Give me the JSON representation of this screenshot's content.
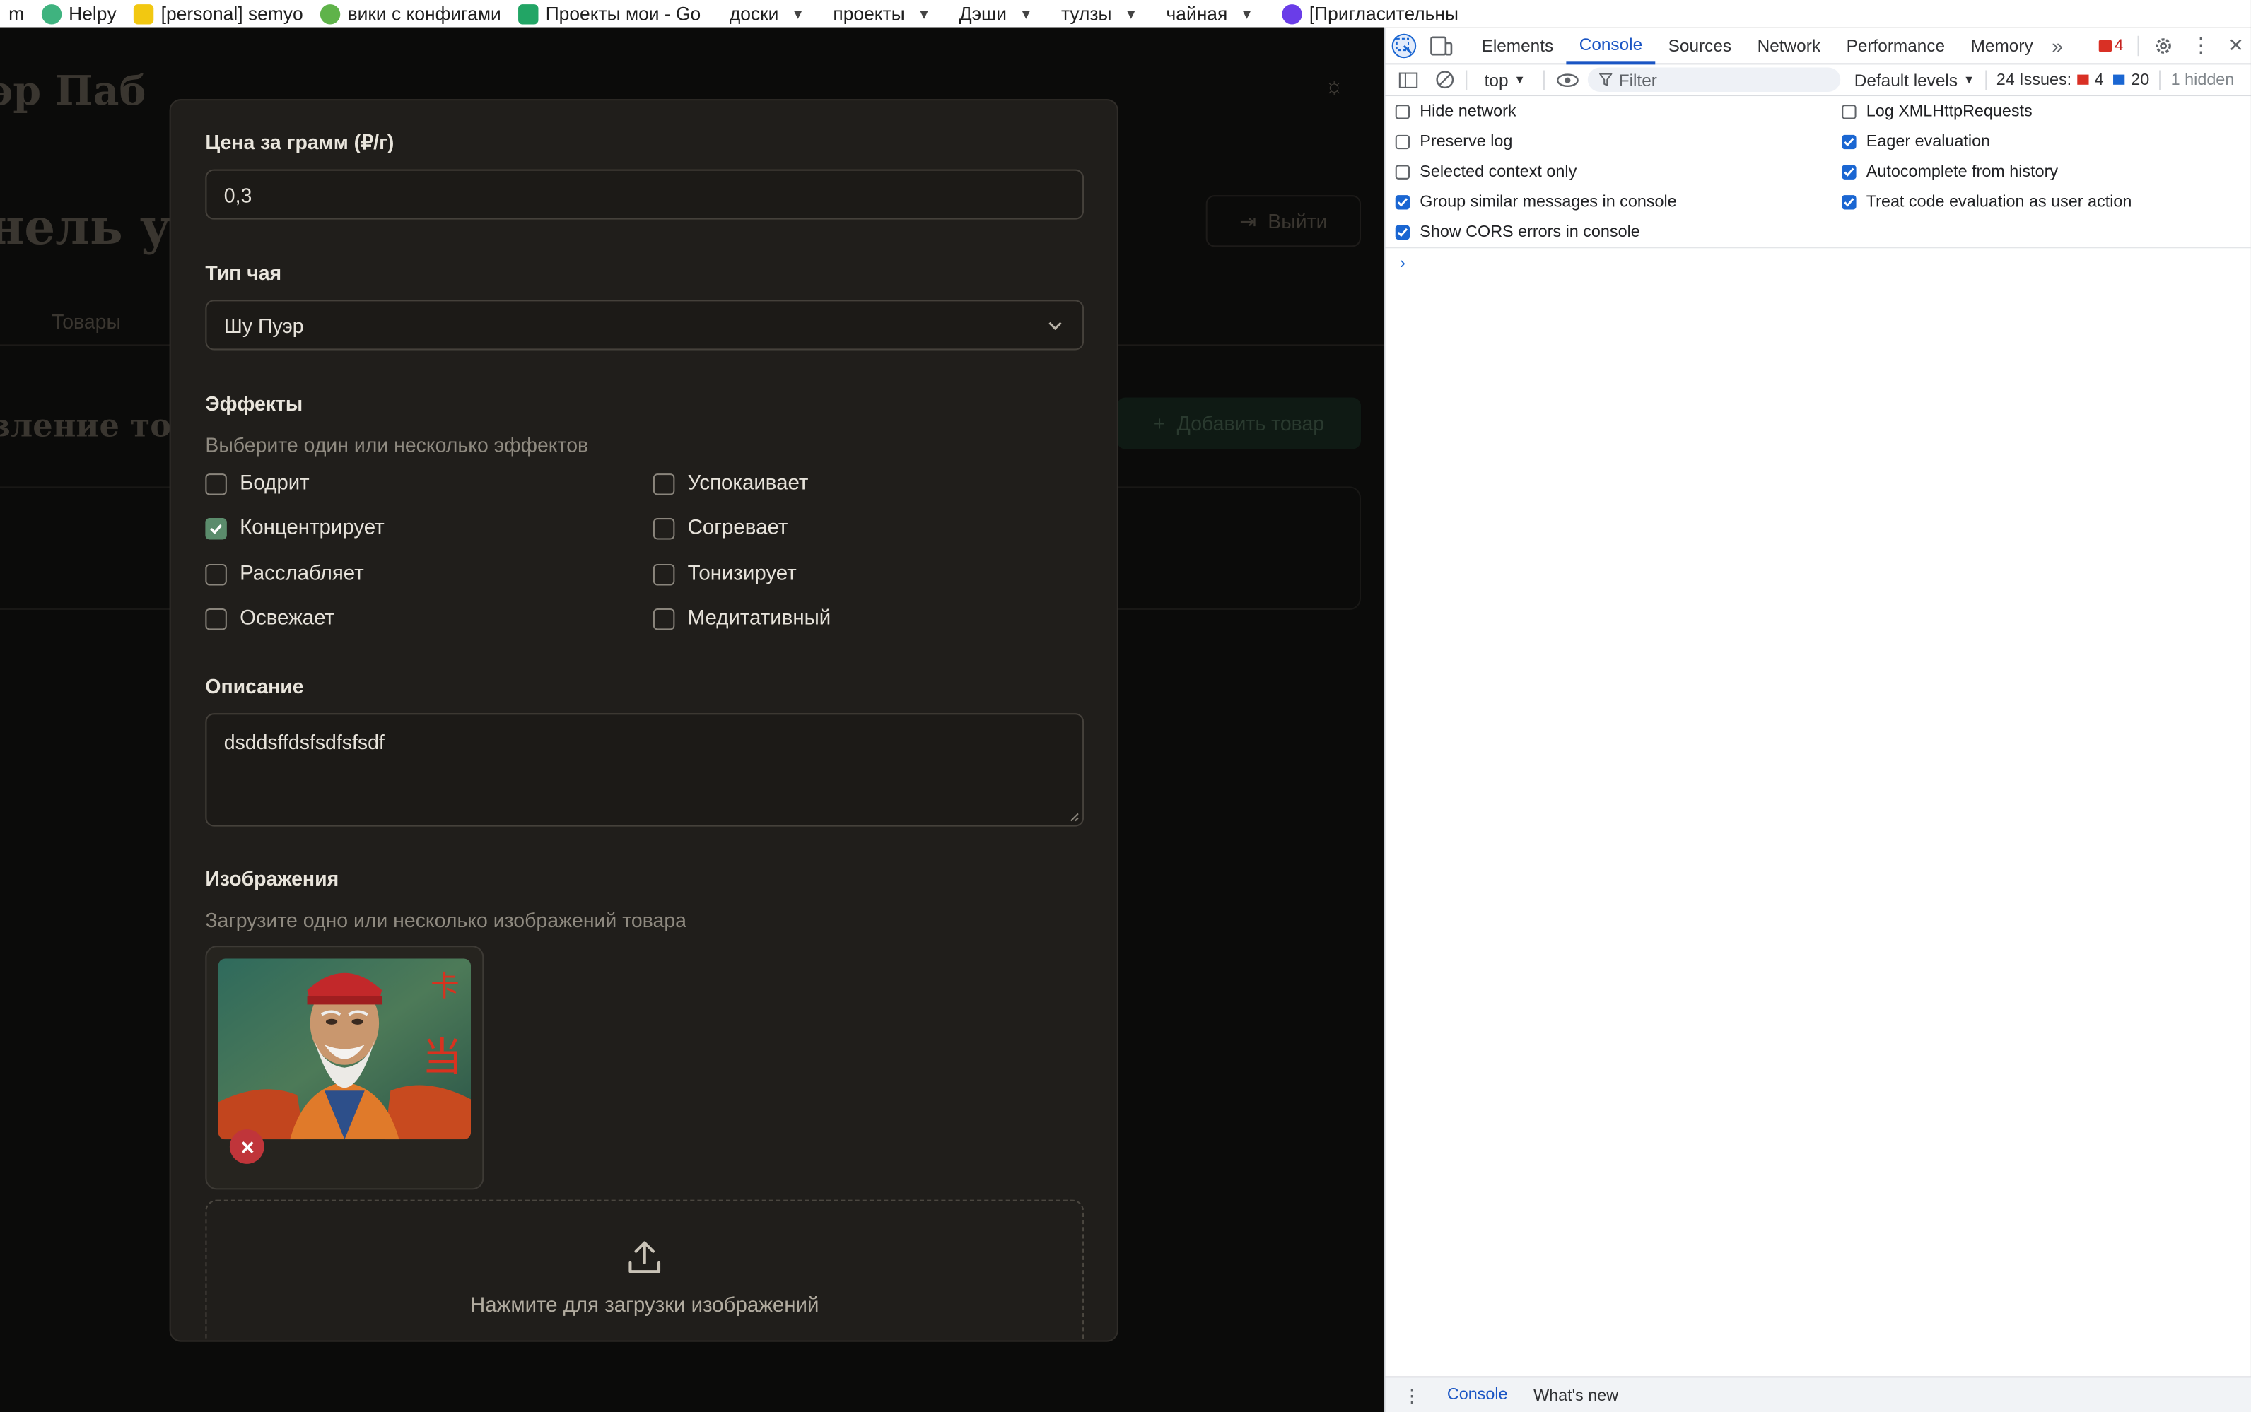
{
  "bookmarks": [
    {
      "label": "m",
      "color": "#ffffff",
      "dropdown": false
    },
    {
      "label": "Helpy",
      "color": "#3fb37f",
      "dropdown": false
    },
    {
      "label": "[personal] semyo",
      "color": "#f2c811",
      "dropdown": false
    },
    {
      "label": "вики с конфигами",
      "color": "#5fb34a",
      "dropdown": false
    },
    {
      "label": "Проекты мои - Go",
      "color": "#22a565",
      "dropdown": false
    },
    {
      "label": "доски",
      "color": "",
      "dropdown": true
    },
    {
      "label": "проекты",
      "color": "",
      "dropdown": true
    },
    {
      "label": "Дэши",
      "color": "",
      "dropdown": true
    },
    {
      "label": "тулзы",
      "color": "",
      "dropdown": true
    },
    {
      "label": "чайная",
      "color": "",
      "dropdown": true
    },
    {
      "label": "[Пригласительны",
      "color": "#6a3de8",
      "dropdown": false
    }
  ],
  "background": {
    "brand": "эр Паб",
    "panel_title": "нель уп",
    "tab_products": "Товары",
    "manage_title": "вление то",
    "logout": "Выйти",
    "add_product": "Добавить товар"
  },
  "form": {
    "price_label": "Цена за грамм (₽/г)",
    "price_value": "0,3",
    "tea_type_label": "Тип чая",
    "tea_type_value": "Шу Пуэр",
    "effects_label": "Эффекты",
    "effects_hint": "Выберите один или несколько эффектов",
    "effects": [
      {
        "label": "Бодрит",
        "checked": false
      },
      {
        "label": "Успокаивает",
        "checked": false
      },
      {
        "label": "Концентрирует",
        "checked": true
      },
      {
        "label": "Согревает",
        "checked": false
      },
      {
        "label": "Расслабляет",
        "checked": false
      },
      {
        "label": "Тонизирует",
        "checked": false
      },
      {
        "label": "Освежает",
        "checked": false
      },
      {
        "label": "Медитативный",
        "checked": false
      }
    ],
    "description_label": "Описание",
    "description_value": "dsddsffdsfsdfsfsdf",
    "images_label": "Изображения",
    "images_hint": "Загрузите одно или несколько изображений товара",
    "upload_text": "Нажмите для загрузки изображений"
  },
  "devtools": {
    "tabs": [
      "Elements",
      "Console",
      "Sources",
      "Network",
      "Performance",
      "Memory"
    ],
    "active_tab": "Console",
    "errors_count": "4",
    "context": "top",
    "filter_placeholder": "Filter",
    "levels": "Default levels",
    "issues_label": "24 Issues:",
    "issues_errors": "4",
    "issues_info": "20",
    "hidden": "1 hidden",
    "options": [
      {
        "label": "Hide network",
        "checked": false
      },
      {
        "label": "Log XMLHttpRequests",
        "checked": false
      },
      {
        "label": "Preserve log",
        "checked": false
      },
      {
        "label": "Eager evaluation",
        "checked": true
      },
      {
        "label": "Selected context only",
        "checked": false
      },
      {
        "label": "Autocomplete from history",
        "checked": true
      },
      {
        "label": "Group similar messages in console",
        "checked": true
      },
      {
        "label": "Treat code evaluation as user action",
        "checked": true
      },
      {
        "label": "Show CORS errors in console",
        "checked": true
      }
    ],
    "drawer_tabs": [
      "Console",
      "What's new"
    ]
  },
  "colors": {
    "accent_green": "#5b8c6c",
    "remove_red": "#c0353a",
    "devtools_blue": "#1a66d2"
  }
}
